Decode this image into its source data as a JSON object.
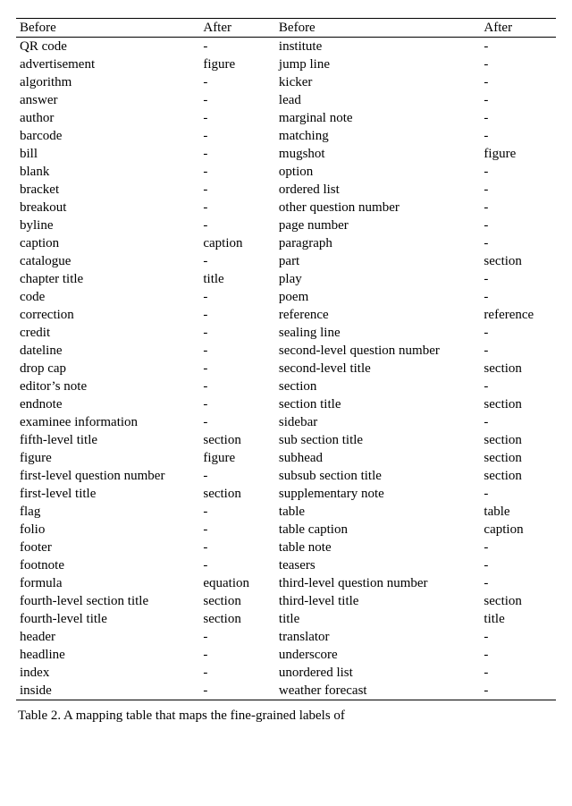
{
  "table": {
    "headers": {
      "before_l": "Before",
      "after_l": "After",
      "before_r": "Before",
      "after_r": "After"
    },
    "rows": [
      {
        "bl": "QR code",
        "al": "-",
        "br": "institute",
        "ar": "-"
      },
      {
        "bl": "advertisement",
        "al": "figure",
        "br": "jump line",
        "ar": "-"
      },
      {
        "bl": "algorithm",
        "al": "-",
        "br": "kicker",
        "ar": "-"
      },
      {
        "bl": "answer",
        "al": "-",
        "br": "lead",
        "ar": "-"
      },
      {
        "bl": "author",
        "al": "-",
        "br": "marginal note",
        "ar": "-"
      },
      {
        "bl": "barcode",
        "al": "-",
        "br": "matching",
        "ar": "-"
      },
      {
        "bl": "bill",
        "al": "-",
        "br": "mugshot",
        "ar": "figure"
      },
      {
        "bl": "blank",
        "al": "-",
        "br": "option",
        "ar": "-"
      },
      {
        "bl": "bracket",
        "al": "-",
        "br": "ordered list",
        "ar": "-"
      },
      {
        "bl": "breakout",
        "al": "-",
        "br": "other question number",
        "ar": "-"
      },
      {
        "bl": "byline",
        "al": "-",
        "br": "page number",
        "ar": "-"
      },
      {
        "bl": "caption",
        "al": "caption",
        "br": "paragraph",
        "ar": "-"
      },
      {
        "bl": "catalogue",
        "al": "-",
        "br": "part",
        "ar": "section"
      },
      {
        "bl": "chapter title",
        "al": "title",
        "br": "play",
        "ar": "-"
      },
      {
        "bl": "code",
        "al": "-",
        "br": "poem",
        "ar": "-"
      },
      {
        "bl": "correction",
        "al": "-",
        "br": "reference",
        "ar": "reference"
      },
      {
        "bl": "credit",
        "al": "-",
        "br": "sealing line",
        "ar": "-"
      },
      {
        "bl": "dateline",
        "al": "-",
        "br": "second-level question number",
        "ar": "-"
      },
      {
        "bl": "drop cap",
        "al": "-",
        "br": "second-level title",
        "ar": "section"
      },
      {
        "bl": "editor’s note",
        "al": "-",
        "br": "section",
        "ar": "-"
      },
      {
        "bl": "endnote",
        "al": "-",
        "br": "section title",
        "ar": "section"
      },
      {
        "bl": "examinee information",
        "al": "-",
        "br": "sidebar",
        "ar": "-"
      },
      {
        "bl": "fifth-level title",
        "al": "section",
        "br": "sub section title",
        "ar": "section"
      },
      {
        "bl": "figure",
        "al": "figure",
        "br": "subhead",
        "ar": "section"
      },
      {
        "bl": "first-level question number",
        "al": "-",
        "br": "subsub section title",
        "ar": "section"
      },
      {
        "bl": "first-level title",
        "al": "section",
        "br": "supplementary note",
        "ar": "-"
      },
      {
        "bl": "flag",
        "al": "-",
        "br": "table",
        "ar": "table"
      },
      {
        "bl": "folio",
        "al": "-",
        "br": "table caption",
        "ar": "caption"
      },
      {
        "bl": "footer",
        "al": "-",
        "br": "table note",
        "ar": "-"
      },
      {
        "bl": "footnote",
        "al": "-",
        "br": "teasers",
        "ar": "-"
      },
      {
        "bl": "formula",
        "al": "equation",
        "br": "third-level question number",
        "ar": "-"
      },
      {
        "bl": "fourth-level section title",
        "al": "section",
        "br": "third-level title",
        "ar": "section"
      },
      {
        "bl": "fourth-level title",
        "al": "section",
        "br": "title",
        "ar": "title"
      },
      {
        "bl": "header",
        "al": "-",
        "br": "translator",
        "ar": "-"
      },
      {
        "bl": "headline",
        "al": "-",
        "br": "underscore",
        "ar": "-"
      },
      {
        "bl": "index",
        "al": "-",
        "br": "unordered list",
        "ar": "-"
      },
      {
        "bl": "inside",
        "al": "-",
        "br": "weather forecast",
        "ar": "-"
      }
    ]
  },
  "caption": "Table 2.  A mapping table that maps the fine-grained labels of"
}
